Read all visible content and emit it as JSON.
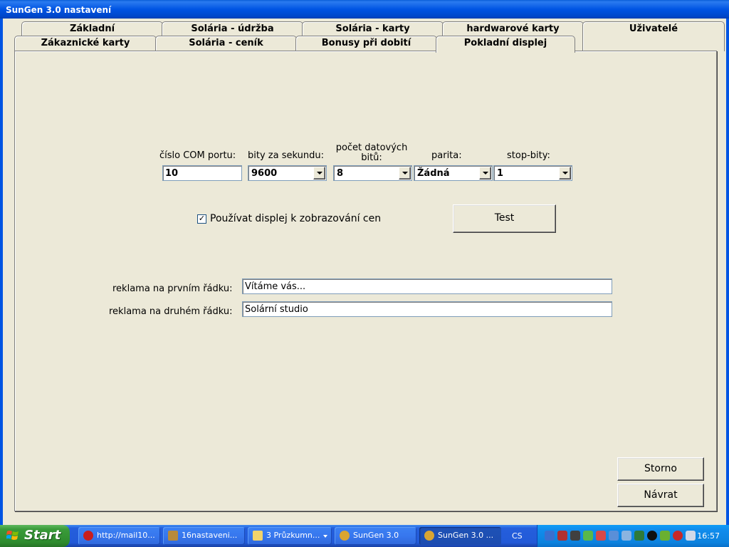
{
  "window": {
    "title": "SunGen 3.0 nastavení"
  },
  "tabs_row1": [
    "Základní",
    "Solária - údržba",
    "Solária - karty",
    "hardwarové karty",
    "Uživatelé"
  ],
  "tabs_row2": [
    "Zákaznické karty",
    "Solária - ceník",
    "Bonusy při dobití",
    "Pokladní displej"
  ],
  "active_tab": "Pokladní displej",
  "com": {
    "port_label": "číslo COM portu:",
    "port_value": "10",
    "baud_label": "bity za sekundu:",
    "baud_value": "9600",
    "databits_label_1": "počet datových",
    "databits_label_2": "bitů:",
    "databits_value": "8",
    "parity_label": "parita:",
    "parity_value": "Žádná",
    "stopbits_label": "stop-bity:",
    "stopbits_value": "1"
  },
  "display": {
    "use_checkbox_label": "Používat displej k zobrazování cen",
    "use_checked": true,
    "check_mark": "✓",
    "test_button": "Test"
  },
  "ads": {
    "line1_label": "reklama na prvním řádku:",
    "line1_value": "Vítáme vás...",
    "line2_label": "reklama na druhém řádku:",
    "line2_value": "Solární studio"
  },
  "buttons": {
    "cancel": "Storno",
    "return": "Návrat"
  },
  "taskbar": {
    "start_label": "Start",
    "items": [
      "http://mail10...",
      "16nastaveni...",
      "3 Průzkumn...",
      "SunGen 3.0",
      "SunGen 3.0 ..."
    ],
    "language": "CS",
    "clock": "16:57"
  }
}
